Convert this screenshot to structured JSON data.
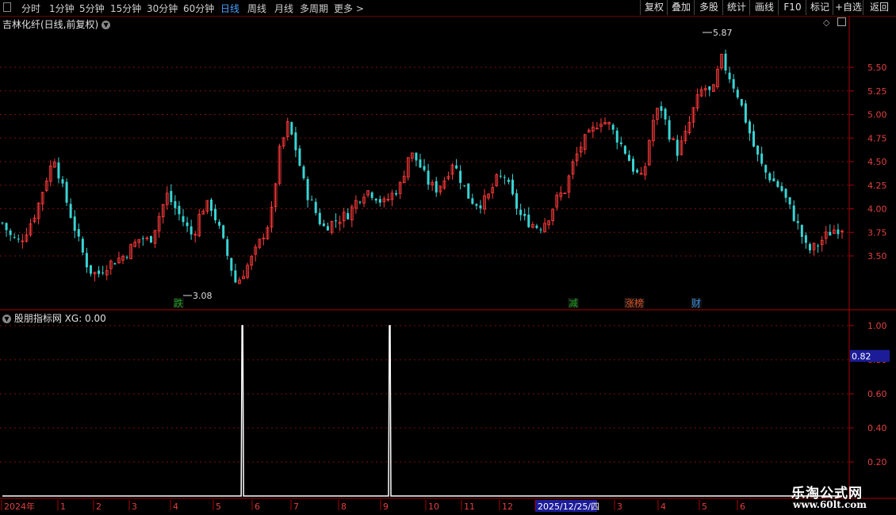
{
  "toolbar": {
    "periods": [
      "分时",
      "1分钟",
      "5分钟",
      "15分钟",
      "30分钟",
      "60分钟",
      "日线",
      "周线",
      "月线",
      "多周期",
      "更多 >"
    ],
    "active_period": "日线",
    "actions": [
      "复权",
      "叠加",
      "多股",
      "统计",
      "画线",
      "F10",
      "标记",
      "+自选",
      "返回"
    ]
  },
  "main_panel": {
    "title": "吉林化纤(日线,前复权)",
    "high_label": "5.87",
    "low_label": "3.08",
    "markers": [
      {
        "text": "跌",
        "color": "#1fa51f"
      },
      {
        "text": "减",
        "color": "#1fa51f"
      },
      {
        "text": "涨榜",
        "color": "#e05020"
      },
      {
        "text": "财",
        "color": "#3b8fe0"
      }
    ]
  },
  "indicator_panel": {
    "title": "股朋指标网",
    "value_label": "XG: 0.00",
    "current_value_tag": "0.82"
  },
  "time_axis": {
    "labels": [
      "2024年",
      "1",
      "2",
      "3",
      "4",
      "5",
      "6",
      "7",
      "8",
      "9",
      "10",
      "11",
      "12",
      "2025/12/25/四",
      "3",
      "4",
      "5",
      "6"
    ]
  },
  "watermark": {
    "line1": "乐淘公式网",
    "line2": "www.60lt.com"
  },
  "chart_data": [
    {
      "type": "candlestick",
      "title": "吉林化纤(日线,前复权)",
      "y_ticks": [
        3.5,
        3.75,
        4.0,
        4.25,
        4.5,
        4.75,
        5.0,
        5.25,
        5.5
      ],
      "ylim": [
        3.0,
        6.0
      ],
      "annotations": [
        {
          "label": "5.87",
          "value": 5.87,
          "kind": "high"
        },
        {
          "label": "3.08",
          "value": 3.08,
          "kind": "low"
        }
      ],
      "close_path": [
        3.85,
        3.7,
        3.65,
        3.8,
        4.0,
        4.3,
        4.55,
        4.2,
        3.9,
        3.6,
        3.35,
        3.3,
        3.4,
        3.45,
        3.5,
        3.6,
        3.7,
        3.65,
        3.9,
        4.15,
        4.0,
        3.85,
        3.7,
        4.0,
        4.05,
        3.8,
        3.5,
        3.2,
        3.35,
        3.5,
        3.7,
        3.9,
        4.6,
        4.9,
        4.6,
        4.2,
        4.0,
        3.8,
        3.85,
        3.9,
        3.95,
        4.1,
        4.2,
        4.15,
        4.05,
        4.15,
        4.25,
        4.6,
        4.5,
        4.3,
        4.2,
        4.3,
        4.5,
        4.3,
        4.1,
        4.05,
        4.1,
        4.3,
        4.35,
        4.1,
        3.9,
        3.85,
        3.8,
        3.9,
        4.1,
        4.2,
        4.5,
        4.7,
        4.8,
        4.95,
        4.9,
        4.75,
        4.6,
        4.4,
        4.3,
        4.9,
        5.1,
        4.8,
        4.6,
        4.8,
        5.1,
        5.3,
        5.2,
        5.6,
        5.4,
        5.2,
        4.9,
        4.6,
        4.4,
        4.3,
        4.2,
        4.0,
        3.8,
        3.55,
        3.6,
        3.7,
        3.78,
        3.8
      ]
    },
    {
      "type": "line",
      "name": "XG",
      "y_ticks": [
        0.2,
        0.4,
        0.6,
        0.8,
        1.0
      ],
      "ylim": [
        0,
        1.1
      ],
      "values": [
        0,
        1,
        0,
        1,
        0
      ],
      "signal_dates_index": [
        0.285,
        0.46
      ]
    }
  ]
}
